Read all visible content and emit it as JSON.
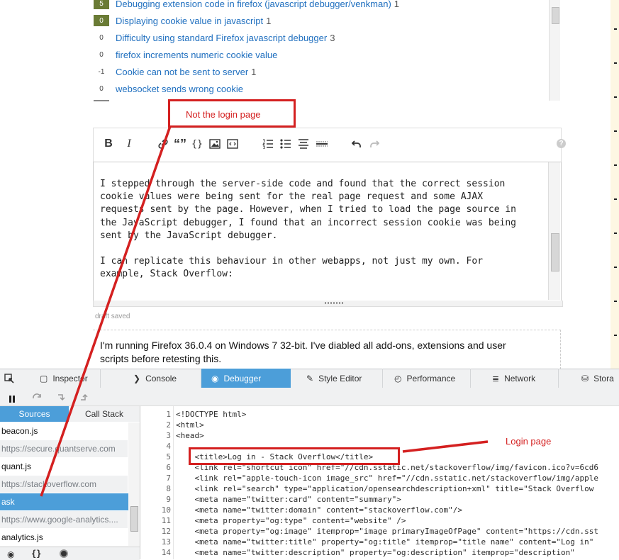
{
  "related": [
    {
      "score": "5",
      "title": "Debugging extension code in firefox (javascript debugger/venkman)",
      "count": "1",
      "hi": true
    },
    {
      "score": "0",
      "title": "Displaying cookie value in javascript",
      "count": "1",
      "hi": true
    },
    {
      "score": "0",
      "title": "Difficulty using standard Firefox javascript debugger",
      "count": "3",
      "hi": false
    },
    {
      "score": "0",
      "title": "firefox increments numeric cookie value",
      "count": "",
      "hi": false
    },
    {
      "score": "-1",
      "title": "Cookie can not be sent to server",
      "count": "1",
      "hi": false
    },
    {
      "score": "0",
      "title": "websocket sends wrong cookie",
      "count": "",
      "hi": false
    }
  ],
  "annotations": {
    "not_login": "Not the login page",
    "login": "Login page"
  },
  "editor": {
    "toolbar": {
      "bold": "B",
      "italic": "I",
      "quote": "“”",
      "code": "{}",
      "help": "?"
    },
    "text": "I stepped through the server-side code and found that the correct session\ncookie values were being sent for the real page request and some AJAX\nrequests sent by the page. However, when I tried to load the page source in\nthe JavaScript debugger, I found that an incorrect session cookie was being\nsent by the JavaScript debugger.\n\nI can replicate this behaviour in other webapps, not just my own. For\nexample, Stack Overflow:",
    "draft_status": "draft saved"
  },
  "preview": {
    "text": "I'm running Firefox 36.0.4 on Windows 7 32-bit. I've diabled all add-ons, extensions and user scripts before retesting this."
  },
  "devtools": {
    "tabs": [
      {
        "label": "Inspector",
        "icon": "inspector-icon",
        "glyph": "▢"
      },
      {
        "label": "Console",
        "icon": "console-icon",
        "glyph": "❯"
      },
      {
        "label": "Debugger",
        "icon": "debugger-icon",
        "glyph": "◉",
        "active": true
      },
      {
        "label": "Style Editor",
        "icon": "style-editor-icon",
        "glyph": "✎"
      },
      {
        "label": "Performance",
        "icon": "performance-icon",
        "glyph": "◴"
      },
      {
        "label": "Network",
        "icon": "network-icon",
        "glyph": "≣"
      },
      {
        "label": "Stora",
        "icon": "storage-icon",
        "glyph": "⛁"
      }
    ],
    "pane_tabs": {
      "sources": "Sources",
      "callstack": "Call Stack"
    },
    "sources": [
      {
        "label": "beacon.js",
        "kind": "file"
      },
      {
        "label": "https://secure.quantserve.com",
        "kind": "grp"
      },
      {
        "label": "quant.js",
        "kind": "file"
      },
      {
        "label": "https://stackoverflow.com",
        "kind": "grp"
      },
      {
        "label": "ask",
        "kind": "sel"
      },
      {
        "label": "https://www.google-analytics....",
        "kind": "grp"
      },
      {
        "label": "analytics.js",
        "kind": "file"
      }
    ],
    "code_lines": [
      "<!DOCTYPE html>",
      "<html>",
      "<head>",
      "",
      "    <title>Log in - Stack Overflow</title>",
      "    <link rel=\"shortcut icon\" href=\"//cdn.sstatic.net/stackoverflow/img/favicon.ico?v=6cd6",
      "    <link rel=\"apple-touch-icon image_src\" href=\"//cdn.sstatic.net/stackoverflow/img/apple",
      "    <link rel=\"search\" type=\"application/opensearchdescription+xml\" title=\"Stack Overflow",
      "    <meta name=\"twitter:card\" content=\"summary\">",
      "    <meta name=\"twitter:domain\" content=\"stackoverflow.com\"/>",
      "    <meta property=\"og:type\" content=\"website\" />",
      "    <meta property=\"og:image\" itemprop=\"image primaryImageOfPage\" content=\"https://cdn.sst",
      "    <meta name=\"twitter:title\" property=\"og:title\" itemprop=\"title name\" content=\"Log in\"",
      "    <meta name=\"twitter:description\" property=\"og:description\" itemprop=\"description\""
    ],
    "line_numbers": [
      "1",
      "2",
      "3",
      "4",
      "5",
      "6",
      "7",
      "8",
      "9",
      "10",
      "11",
      "12",
      "13",
      "14"
    ]
  },
  "colors": {
    "annotation_red": "#d42020",
    "devtools_bg": "#f0f1f2",
    "active_tab": "#4c9ed9",
    "right_strip": "#fdf7e3"
  }
}
